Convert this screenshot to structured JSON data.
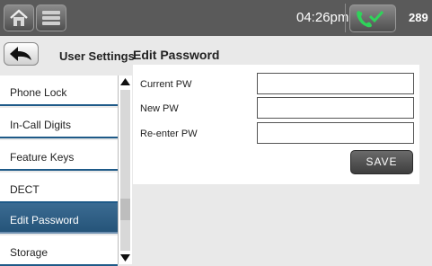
{
  "status_bar": {
    "home_icon": "home-icon",
    "menu_icon": "list-menu-icon",
    "time": "04:26pm",
    "phone_icon": "phone-check-icon",
    "extension": "289",
    "accent_green": "#2fd35a"
  },
  "header": {
    "back_icon": "back-arrow-icon",
    "left_title": "User Settings",
    "right_title": "Edit Password"
  },
  "sidebar": {
    "items": [
      {
        "label": "Phone Lock",
        "active": false
      },
      {
        "label": "In-Call Digits",
        "active": false
      },
      {
        "label": "Feature Keys",
        "active": false
      },
      {
        "label": "DECT",
        "active": false
      },
      {
        "label": "Edit Password",
        "active": true
      },
      {
        "label": "Storage",
        "active": false
      }
    ],
    "active_color": "#2e5f86"
  },
  "form": {
    "fields": [
      {
        "label": "Current PW",
        "value": ""
      },
      {
        "label": "New PW",
        "value": ""
      },
      {
        "label": "Re-enter PW",
        "value": ""
      }
    ],
    "save_label": "SAVE"
  }
}
